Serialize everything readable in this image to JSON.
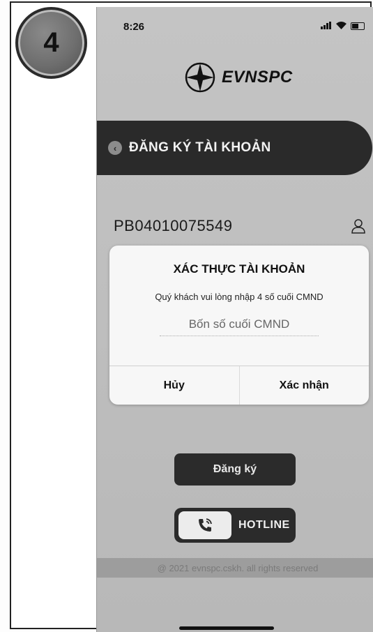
{
  "step": {
    "number": "4"
  },
  "status_bar": {
    "time": "8:26",
    "signal": "•ıl",
    "wifi": "▼"
  },
  "brand": {
    "name": "EVNSPC",
    "icon": "compass-star-icon"
  },
  "header": {
    "back_icon": "chevron-left-icon",
    "title": "ĐĂNG KÝ TÀI KHOẢN"
  },
  "account": {
    "id": "PB04010075549",
    "icon": "user-icon"
  },
  "dialog": {
    "title": "XÁC THỰC TÀI KHOẢN",
    "message": "Quý khách vui lòng nhập 4 số cuối CMND",
    "input_placeholder": "Bốn số cuối CMND",
    "input_value": "",
    "cancel_label": "Hủy",
    "confirm_label": "Xác nhận"
  },
  "actions": {
    "register_label": "Đăng ký",
    "hotline_label": "HOTLINE",
    "hotline_icon": "phone-call-icon"
  },
  "footer": {
    "copyright": "@ 2021 evnspc.cskh. all rights reserved"
  }
}
